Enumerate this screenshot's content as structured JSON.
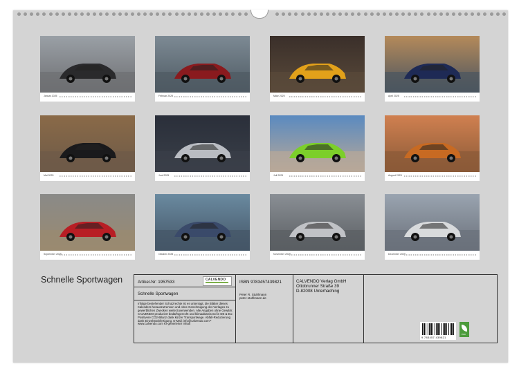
{
  "months": [
    {
      "label": "Januar 2025",
      "sky": "#9aa0a6",
      "ground": "#6e6f72",
      "car": "#2a2a2c"
    },
    {
      "label": "Februar 2025",
      "sky": "#7d8a94",
      "ground": "#4e5a63",
      "car": "#8a1a1e"
    },
    {
      "label": "März 2025",
      "sky": "#3a2f2a",
      "ground": "#5a4a3a",
      "car": "#e2a11a"
    },
    {
      "label": "April 2025",
      "sky": "#b58a5a",
      "ground": "#4a5560",
      "car": "#1e2a55"
    },
    {
      "label": "Mai 2025",
      "sky": "#8a6a48",
      "ground": "#6d5a48",
      "car": "#1a1a1c"
    },
    {
      "label": "Juni 2025",
      "sky": "#2a2f3a",
      "ground": "#3a3f48",
      "car": "#b9bcc2"
    },
    {
      "label": "Juli 2025",
      "sky": "#5a8ac0",
      "ground": "#b8a898",
      "car": "#7ccf2a"
    },
    {
      "label": "August 2025",
      "sky": "#d08050",
      "ground": "#8a5a38",
      "car": "#c86a22"
    },
    {
      "label": "September 2025",
      "sky": "#8a8a88",
      "ground": "#9a8a70",
      "car": "#b81e24"
    },
    {
      "label": "Oktober 2025",
      "sky": "#6a8aa0",
      "ground": "#445566",
      "car": "#3a4a6a"
    },
    {
      "label": "November 2025",
      "sky": "#8a8f95",
      "ground": "#5a5e62",
      "car": "#c0c2c6"
    },
    {
      "label": "Dezember 2025",
      "sky": "#9aa4b0",
      "ground": "#6a707a",
      "car": "#d8dadc"
    }
  ],
  "title": "Schnelle Sportwagen",
  "info": {
    "artikel": "Artikel-Nr: 1957533",
    "calvendo_logo": "CALVENDO",
    "calendar_name": "Schnelle Sportwagen",
    "legal": "Infolge bestehender Schutzrechte ist es untersagt, die Blätter dieses Kalenders herauszutrennen und ohne Genehmigung des Verlages zu gewerblichen Zwecken weiterzuverwenden. Alle Angaben ohne Gewähr. CALVENDO produziert bedarfsgerecht und klimaabweisend in DE & EU. Positivere CO2-Bilanz dank kürzer Transportwege. Abfall-Reduzierung dank Einzelstückfertigung. E-Mail: info@calvendo.com • www.calvendo.com KI-generierter Inhalt",
    "isbn": "ISBN 9783457439821",
    "author": "Peter R. Stuhlmann",
    "author_web": "peter-stuhlmann.de",
    "publisher": "CALVENDO Verlag GmbH",
    "street": "Ottobrunner Straße 39",
    "city": "D-82008 Unterhaching",
    "barcode_number": "9 783457 439821",
    "eco_label": "eco"
  },
  "colors": {
    "sheet": "#d4d4d4",
    "border": "#333333",
    "eco_green": "#4c9b3c"
  }
}
